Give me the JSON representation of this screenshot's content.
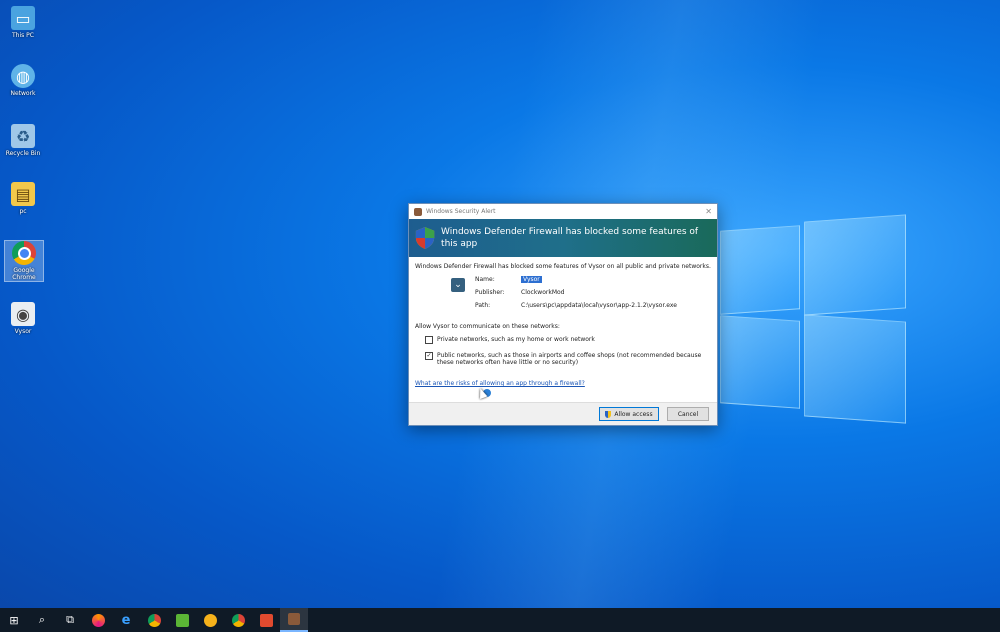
{
  "desktop": {
    "icons": [
      {
        "label": "This PC",
        "icon": "computer-icon"
      },
      {
        "label": "Network",
        "icon": "network-globe-icon"
      },
      {
        "label": "Recycle Bin",
        "icon": "recycle-bin-icon"
      },
      {
        "label": "pc",
        "icon": "user-folder-icon"
      },
      {
        "label": "Google Chrome",
        "icon": "chrome-icon"
      },
      {
        "label": "Vysor",
        "icon": "vysor-icon"
      }
    ]
  },
  "dialog": {
    "title": "Windows Security Alert",
    "close_glyph": "✕",
    "banner": "Windows Defender Firewall has blocked some features of this app",
    "intro": "Windows Defender Firewall has blocked some features of Vysor on all public and private networks.",
    "fields": {
      "name_label": "Name:",
      "name_value": "Vysor",
      "publisher_label": "Publisher:",
      "publisher_value": "ClockworkMod",
      "path_label": "Path:",
      "path_value": "C:\\users\\pc\\appdata\\local\\vysor\\app-2.1.2\\vysor.exe"
    },
    "allow_label": "Allow Vysor to communicate on these networks:",
    "private_option": "Private networks, such as my home or work network",
    "public_option": "Public networks, such as those in airports and coffee shops (not recommended because these networks often have little or no security)",
    "risks_link": "What are the risks of allowing an app through a firewall?",
    "allow_button": "Allow access",
    "cancel_button": "Cancel",
    "private_checked": false,
    "public_checked": true,
    "check_glyph": "✓"
  },
  "taskbar": {
    "start_glyph": "⊞",
    "search_glyph": "⌕",
    "taskview_glyph": "⧉",
    "apps": [
      "firefox-icon",
      "edge-icon",
      "chrome-icon",
      "camtasia-icon",
      "orange-app-icon",
      "chrome-alt-icon",
      "red-app-icon",
      "vysor-icon"
    ]
  },
  "colors": {
    "desktop_blue": "#0a78e6",
    "banner_teal": "#1f6f8a",
    "taskbar": "#0f1a26",
    "link": "#1a55b5"
  }
}
